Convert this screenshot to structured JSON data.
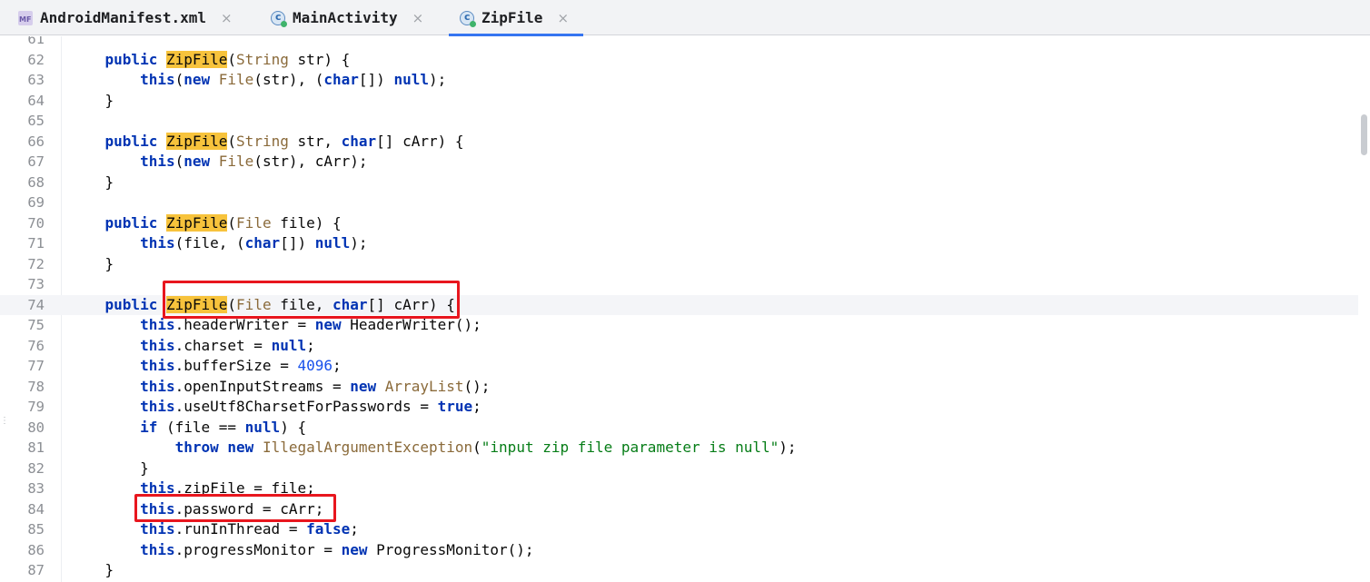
{
  "tabs": [
    {
      "label": "AndroidManifest.xml",
      "icon": "manifest-file-icon",
      "active": false
    },
    {
      "label": "MainActivity",
      "icon": "java-class-icon",
      "active": false
    },
    {
      "label": "ZipFile",
      "icon": "java-class-icon",
      "active": true
    }
  ],
  "close_glyph": "×",
  "editor": {
    "highlight_color": "#f7c33c",
    "annotation_color": "#e8161e",
    "current_line": "74",
    "lines": [
      {
        "n": "61",
        "tokens": []
      },
      {
        "n": "62",
        "tokens": [
          [
            "    ",
            ""
          ],
          [
            "public",
            "kw"
          ],
          [
            " ",
            ""
          ],
          [
            "ZipFile",
            "hl"
          ],
          [
            "(",
            ""
          ],
          [
            "String",
            "ty"
          ],
          [
            " str) {",
            ""
          ]
        ]
      },
      {
        "n": "63",
        "tokens": [
          [
            "        ",
            ""
          ],
          [
            "this",
            "kw"
          ],
          [
            "(",
            ""
          ],
          [
            "new",
            "kw"
          ],
          [
            " ",
            ""
          ],
          [
            "File",
            "ty"
          ],
          [
            "(str), (",
            ""
          ],
          [
            "char",
            "kw"
          ],
          [
            "[]) ",
            ""
          ],
          [
            "null",
            "kw"
          ],
          [
            ");",
            ""
          ]
        ]
      },
      {
        "n": "64",
        "tokens": [
          [
            "    }",
            ""
          ]
        ]
      },
      {
        "n": "65",
        "tokens": []
      },
      {
        "n": "66",
        "tokens": [
          [
            "    ",
            ""
          ],
          [
            "public",
            "kw"
          ],
          [
            " ",
            ""
          ],
          [
            "ZipFile",
            "hl"
          ],
          [
            "(",
            ""
          ],
          [
            "String",
            "ty"
          ],
          [
            " str, ",
            ""
          ],
          [
            "char",
            "kw"
          ],
          [
            "[] cArr) {",
            ""
          ]
        ]
      },
      {
        "n": "67",
        "tokens": [
          [
            "        ",
            ""
          ],
          [
            "this",
            "kw"
          ],
          [
            "(",
            ""
          ],
          [
            "new",
            "kw"
          ],
          [
            " ",
            ""
          ],
          [
            "File",
            "ty"
          ],
          [
            "(str), cArr);",
            ""
          ]
        ]
      },
      {
        "n": "68",
        "tokens": [
          [
            "    }",
            ""
          ]
        ]
      },
      {
        "n": "69",
        "tokens": []
      },
      {
        "n": "70",
        "tokens": [
          [
            "    ",
            ""
          ],
          [
            "public",
            "kw"
          ],
          [
            " ",
            ""
          ],
          [
            "ZipFile",
            "hl"
          ],
          [
            "(",
            ""
          ],
          [
            "File",
            "ty"
          ],
          [
            " file) {",
            ""
          ]
        ]
      },
      {
        "n": "71",
        "tokens": [
          [
            "        ",
            ""
          ],
          [
            "this",
            "kw"
          ],
          [
            "(file, (",
            ""
          ],
          [
            "char",
            "kw"
          ],
          [
            "[]) ",
            ""
          ],
          [
            "null",
            "kw"
          ],
          [
            ");",
            ""
          ]
        ]
      },
      {
        "n": "72",
        "tokens": [
          [
            "    }",
            ""
          ]
        ]
      },
      {
        "n": "73",
        "tokens": []
      },
      {
        "n": "74",
        "tokens": [
          [
            "    ",
            ""
          ],
          [
            "public",
            "kw"
          ],
          [
            " ",
            ""
          ],
          [
            "ZipFile",
            "hl"
          ],
          [
            "(",
            ""
          ],
          [
            "File",
            "ty"
          ],
          [
            " file, ",
            ""
          ],
          [
            "char",
            "kw"
          ],
          [
            "[] cArr) {",
            ""
          ]
        ]
      },
      {
        "n": "75",
        "tokens": [
          [
            "        ",
            ""
          ],
          [
            "this",
            "kw"
          ],
          [
            ".headerWriter = ",
            ""
          ],
          [
            "new",
            "kw"
          ],
          [
            " HeaderWriter();",
            ""
          ]
        ]
      },
      {
        "n": "76",
        "tokens": [
          [
            "        ",
            ""
          ],
          [
            "this",
            "kw"
          ],
          [
            ".charset = ",
            ""
          ],
          [
            "null",
            "kw"
          ],
          [
            ";",
            ""
          ]
        ]
      },
      {
        "n": "77",
        "tokens": [
          [
            "        ",
            ""
          ],
          [
            "this",
            "kw"
          ],
          [
            ".bufferSize = ",
            ""
          ],
          [
            "4096",
            "num"
          ],
          [
            ";",
            ""
          ]
        ]
      },
      {
        "n": "78",
        "tokens": [
          [
            "        ",
            ""
          ],
          [
            "this",
            "kw"
          ],
          [
            ".openInputStreams = ",
            ""
          ],
          [
            "new",
            "kw"
          ],
          [
            " ",
            ""
          ],
          [
            "ArrayList",
            "ty"
          ],
          [
            "();",
            ""
          ]
        ]
      },
      {
        "n": "79",
        "tokens": [
          [
            "        ",
            ""
          ],
          [
            "this",
            "kw"
          ],
          [
            ".useUtf8CharsetForPasswords = ",
            ""
          ],
          [
            "true",
            "kw"
          ],
          [
            ";",
            ""
          ]
        ]
      },
      {
        "n": "80",
        "tokens": [
          [
            "        ",
            ""
          ],
          [
            "if",
            "kw"
          ],
          [
            " (file == ",
            ""
          ],
          [
            "null",
            "kw"
          ],
          [
            ") {",
            ""
          ]
        ]
      },
      {
        "n": "81",
        "tokens": [
          [
            "            ",
            ""
          ],
          [
            "throw",
            "kw"
          ],
          [
            " ",
            ""
          ],
          [
            "new",
            "kw"
          ],
          [
            " ",
            ""
          ],
          [
            "IllegalArgumentException",
            "ty"
          ],
          [
            "(",
            ""
          ],
          [
            "\"input zip file parameter is null\"",
            "str"
          ],
          [
            ");",
            ""
          ]
        ]
      },
      {
        "n": "82",
        "tokens": [
          [
            "        }",
            ""
          ]
        ]
      },
      {
        "n": "83",
        "tokens": [
          [
            "        ",
            ""
          ],
          [
            "this",
            "kw"
          ],
          [
            ".zipFile = file;",
            ""
          ]
        ]
      },
      {
        "n": "84",
        "tokens": [
          [
            "        ",
            ""
          ],
          [
            "this",
            "kw"
          ],
          [
            ".password = cArr;",
            ""
          ]
        ]
      },
      {
        "n": "85",
        "tokens": [
          [
            "        ",
            ""
          ],
          [
            "this",
            "kw"
          ],
          [
            ".runInThread = ",
            ""
          ],
          [
            "false",
            "kw"
          ],
          [
            ";",
            ""
          ]
        ]
      },
      {
        "n": "86",
        "tokens": [
          [
            "        ",
            ""
          ],
          [
            "this",
            "kw"
          ],
          [
            ".progressMonitor = ",
            ""
          ],
          [
            "new",
            "kw"
          ],
          [
            " ProgressMonitor();",
            ""
          ]
        ]
      },
      {
        "n": "87",
        "tokens": [
          [
            "    }",
            ""
          ]
        ]
      }
    ]
  }
}
